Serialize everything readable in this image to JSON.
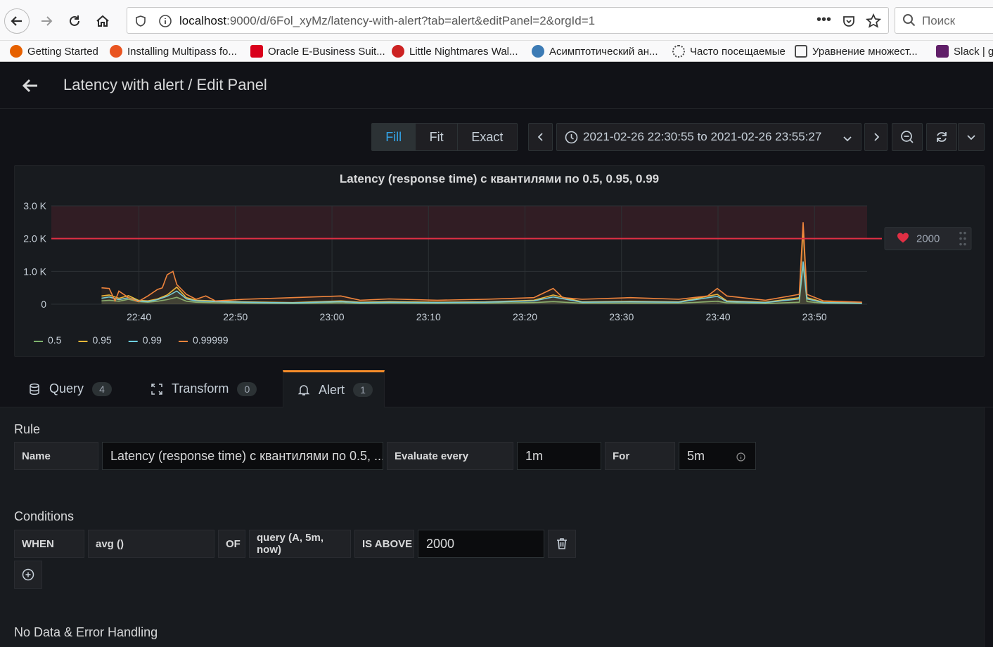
{
  "browser": {
    "url_host": "localhost",
    "url_rest": ":9000/d/6Fol_xyMz/latency-with-alert?tab=alert&editPanel=2&orgId=1",
    "search_placeholder": "Поиск",
    "bookmarks": [
      {
        "label": "Getting Started",
        "color": "#e66000"
      },
      {
        "label": "Installing Multipass fo...",
        "color": "#e95420"
      },
      {
        "label": "Oracle E-Business Suit...",
        "color": "#d9001b"
      },
      {
        "label": "Little Nightmares Wal...",
        "color": "#cc2222"
      },
      {
        "label": "Асимптотический ан...",
        "color": "#3c7bb5"
      },
      {
        "label": "Часто посещаемые",
        "color": "#4a4a4a"
      },
      {
        "label": "Уравнение множест...",
        "color": "#4a4a4a"
      },
      {
        "label": "Slack | g",
        "color": "#611f69"
      }
    ]
  },
  "header": {
    "title": "Latency with alert / Edit Panel"
  },
  "toolbar": {
    "view_modes": [
      "Fill",
      "Fit",
      "Exact"
    ],
    "active_mode": "Fill",
    "time_range": "2021-02-26 22:30:55 to 2021-02-26 23:55:27"
  },
  "panel": {
    "title": "Latency (response time) с квантилями по 0.5, 0.95, 0.99",
    "threshold_label": "2000"
  },
  "chart_data": {
    "type": "line",
    "title": "Latency (response time) с квантилями по 0.5, 0.95, 0.99",
    "y_ticks": [
      "3.0 K",
      "2.0 K",
      "1.0 K",
      "0"
    ],
    "ylim": [
      0,
      3000
    ],
    "x_ticks": [
      "22:40",
      "22:50",
      "23:00",
      "23:10",
      "23:20",
      "23:30",
      "23:40",
      "23:50"
    ],
    "x_tick_minutes": [
      9.08,
      19.08,
      29.08,
      39.08,
      49.08,
      59.08,
      69.08,
      79.08
    ],
    "xlim_minutes": [
      0,
      84.53
    ],
    "threshold": 2000,
    "grid": true,
    "legend_position": "bottom-left",
    "series": [
      {
        "name": "0.5",
        "color": "#7eb26d",
        "points": [
          [
            5.2,
            100
          ],
          [
            6,
            120
          ],
          [
            7,
            90
          ],
          [
            8,
            150
          ],
          [
            9,
            80
          ],
          [
            10,
            60
          ],
          [
            11,
            90
          ],
          [
            12,
            140
          ],
          [
            13,
            210
          ],
          [
            14,
            90
          ],
          [
            15,
            60
          ],
          [
            17,
            40
          ],
          [
            20,
            30
          ],
          [
            25,
            20
          ],
          [
            30,
            40
          ],
          [
            32,
            20
          ],
          [
            35,
            30
          ],
          [
            40,
            25
          ],
          [
            45,
            30
          ],
          [
            50,
            50
          ],
          [
            52,
            80
          ],
          [
            55,
            30
          ],
          [
            60,
            30
          ],
          [
            65,
            30
          ],
          [
            69,
            90
          ],
          [
            70,
            40
          ],
          [
            74,
            20
          ],
          [
            77.5,
            60
          ],
          [
            77.9,
            1200
          ],
          [
            78.3,
            80
          ],
          [
            80,
            30
          ],
          [
            84,
            20
          ]
        ]
      },
      {
        "name": "0.95",
        "color": "#eab839",
        "points": [
          [
            5.2,
            250
          ],
          [
            6,
            280
          ],
          [
            7,
            180
          ],
          [
            8,
            260
          ],
          [
            9,
            120
          ],
          [
            10,
            100
          ],
          [
            11,
            160
          ],
          [
            12,
            280
          ],
          [
            13,
            520
          ],
          [
            14,
            200
          ],
          [
            15,
            120
          ],
          [
            17,
            100
          ],
          [
            20,
            70
          ],
          [
            25,
            50
          ],
          [
            30,
            100
          ],
          [
            32,
            60
          ],
          [
            35,
            80
          ],
          [
            40,
            60
          ],
          [
            45,
            70
          ],
          [
            50,
            120
          ],
          [
            52,
            280
          ],
          [
            55,
            70
          ],
          [
            60,
            90
          ],
          [
            65,
            70
          ],
          [
            69,
            300
          ],
          [
            70,
            100
          ],
          [
            74,
            60
          ],
          [
            77.5,
            200
          ],
          [
            77.9,
            2300
          ],
          [
            78.3,
            200
          ],
          [
            80,
            60
          ],
          [
            84,
            40
          ]
        ]
      },
      {
        "name": "0.99",
        "color": "#6ed0e0",
        "points": [
          [
            5.2,
            180
          ],
          [
            6,
            220
          ],
          [
            7,
            140
          ],
          [
            8,
            200
          ],
          [
            9,
            100
          ],
          [
            10,
            80
          ],
          [
            11,
            140
          ],
          [
            12,
            240
          ],
          [
            13,
            400
          ],
          [
            14,
            160
          ],
          [
            15,
            100
          ],
          [
            17,
            80
          ],
          [
            20,
            60
          ],
          [
            25,
            40
          ],
          [
            30,
            80
          ],
          [
            32,
            50
          ],
          [
            35,
            60
          ],
          [
            40,
            50
          ],
          [
            45,
            60
          ],
          [
            50,
            100
          ],
          [
            52,
            220
          ],
          [
            55,
            60
          ],
          [
            60,
            70
          ],
          [
            65,
            60
          ],
          [
            69,
            240
          ],
          [
            70,
            80
          ],
          [
            74,
            50
          ],
          [
            77.5,
            160
          ],
          [
            77.9,
            1300
          ],
          [
            78.3,
            160
          ],
          [
            80,
            50
          ],
          [
            84,
            30
          ]
        ]
      },
      {
        "name": "0.99999",
        "color": "#ef843c",
        "points": [
          [
            5.2,
            500
          ],
          [
            6,
            480
          ],
          [
            6.6,
            100
          ],
          [
            7,
            400
          ],
          [
            8,
            200
          ],
          [
            9,
            80
          ],
          [
            10,
            250
          ],
          [
            11,
            450
          ],
          [
            11.5,
            500
          ],
          [
            12,
            900
          ],
          [
            12.6,
            1000
          ],
          [
            13,
            600
          ],
          [
            14,
            300
          ],
          [
            15,
            150
          ],
          [
            16,
            250
          ],
          [
            17,
            100
          ],
          [
            20,
            150
          ],
          [
            25,
            200
          ],
          [
            30,
            250
          ],
          [
            32,
            120
          ],
          [
            35,
            160
          ],
          [
            40,
            120
          ],
          [
            45,
            150
          ],
          [
            50,
            200
          ],
          [
            52,
            480
          ],
          [
            53,
            200
          ],
          [
            55,
            150
          ],
          [
            60,
            200
          ],
          [
            65,
            150
          ],
          [
            68,
            250
          ],
          [
            69,
            480
          ],
          [
            70,
            250
          ],
          [
            74,
            120
          ],
          [
            77.5,
            300
          ],
          [
            77.9,
            2500
          ],
          [
            78.3,
            300
          ],
          [
            80,
            100
          ],
          [
            84,
            60
          ]
        ]
      }
    ]
  },
  "tabs": [
    {
      "label": "Query",
      "count": "4"
    },
    {
      "label": "Transform",
      "count": "0"
    },
    {
      "label": "Alert",
      "count": "1"
    }
  ],
  "rule": {
    "section_title": "Rule",
    "name_label": "Name",
    "name_value": "Latency (response time) с квантилями по 0.5, ...",
    "evaluate_label": "Evaluate every",
    "evaluate_value": "1m",
    "for_label": "For",
    "for_value": "5m"
  },
  "conditions": {
    "section_title": "Conditions",
    "when": "WHEN",
    "reducer": "avg ()",
    "of": "OF",
    "query": "query (A, 5m, now)",
    "evaluator": "IS ABOVE",
    "threshold": "2000"
  },
  "no_data": {
    "section_title": "No Data & Error Handling"
  },
  "colors": {
    "accent": "#33a2e5",
    "alert_tab": "#f58c2a",
    "threshold_line": "#e02f44",
    "background": "#111217",
    "panel": "#181b1f"
  }
}
